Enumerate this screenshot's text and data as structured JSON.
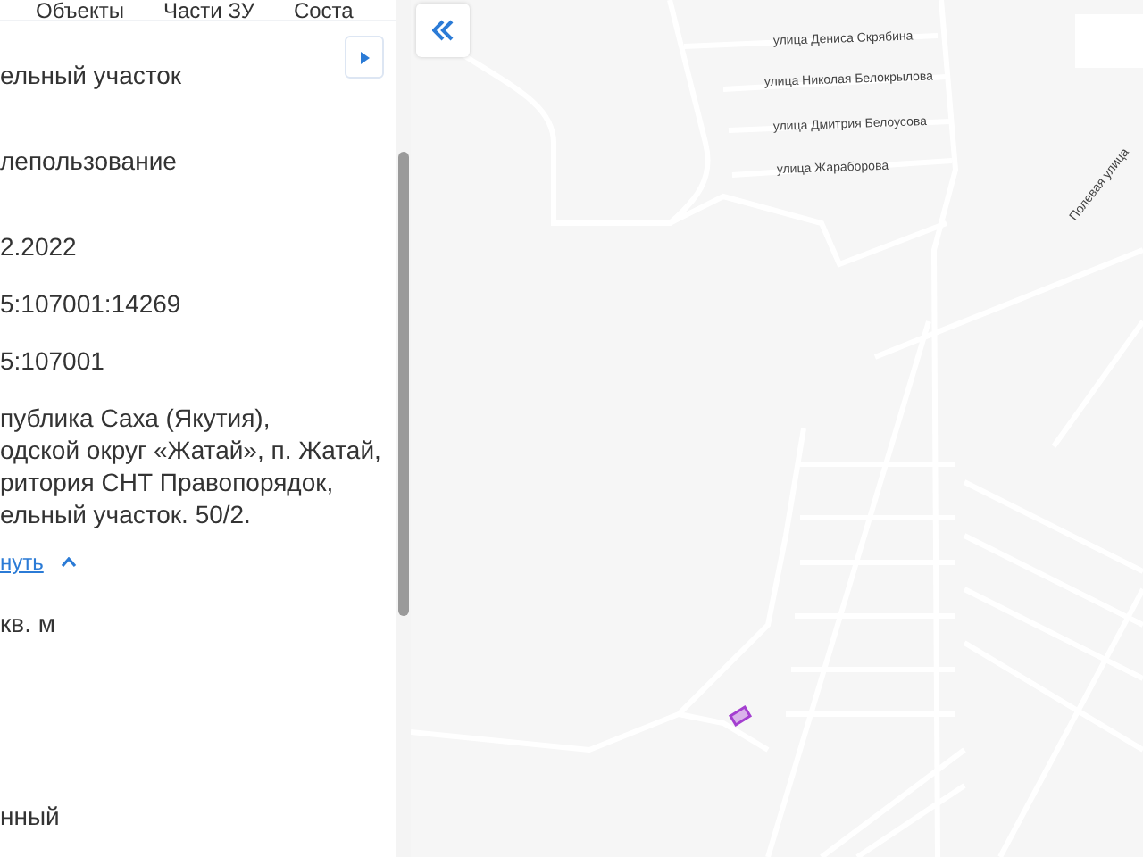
{
  "panel": {
    "tabs": [
      {
        "label": "Объекты"
      },
      {
        "label": "Части ЗУ"
      },
      {
        "label": "Соста"
      }
    ],
    "fields": [
      {
        "value": "ельный участок"
      },
      {
        "value": "лепользование"
      },
      {
        "value": "2.2022"
      },
      {
        "value": "5:107001:14269"
      },
      {
        "value": "5:107001"
      },
      {
        "value": "публика Саха (Якутия),\nодской округ «Жатай», п. Жатай,\nритория СНТ Правопорядок,\nельный участок. 50/2."
      }
    ],
    "toggle_link": {
      "label": "нуть",
      "expanded": true
    },
    "fields_after": [
      {
        "value": "кв. м"
      },
      {
        "value": "нный"
      }
    ]
  },
  "map": {
    "street_labels": [
      {
        "text": "улица Дениса Скрябина"
      },
      {
        "text": "улица Николая Белокрылова"
      },
      {
        "text": "улица Дмитрия Белоусова"
      },
      {
        "text": "улица Жараборова"
      },
      {
        "text": "Полевая улица"
      }
    ]
  }
}
